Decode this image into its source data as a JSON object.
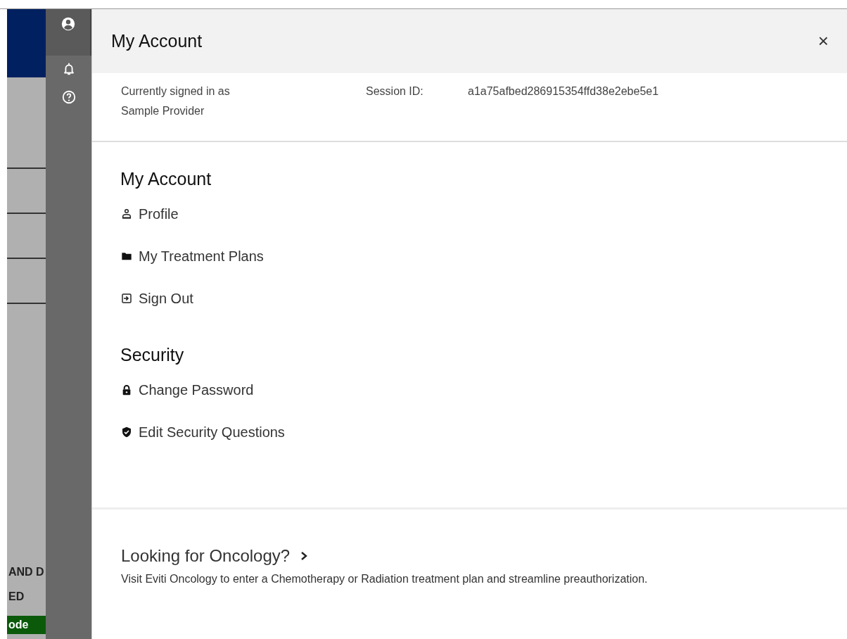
{
  "background_app": {
    "texts": [
      "AND D",
      "ED"
    ],
    "button": "ode"
  },
  "sidebar": {
    "items": [
      {
        "kind": "user",
        "selected": true
      },
      {
        "kind": "bell",
        "selected": false
      },
      {
        "kind": "help",
        "selected": false
      }
    ]
  },
  "panel": {
    "title": "My Account",
    "close": "×",
    "signed_in_label": "Currently signed in as",
    "user_name": "Sample Provider",
    "session_label": "Session ID:",
    "session_id": "a1a75afbed286915354ffd38e2ebe5e1",
    "sections": [
      {
        "heading": "My Account",
        "items": [
          {
            "kind": "profile",
            "label": "Profile"
          },
          {
            "kind": "folder",
            "label": "My Treatment Plans"
          },
          {
            "kind": "signout",
            "label": "Sign Out"
          }
        ]
      },
      {
        "heading": "Security",
        "items": [
          {
            "kind": "lock",
            "label": "Change Password"
          },
          {
            "kind": "shield",
            "label": "Edit Security Questions"
          }
        ]
      }
    ],
    "promo": {
      "title": "Looking for Oncology?",
      "text": "Visit Eviti Oncology to enter a Chemotherapy or Radiation treatment plan and streamline preauthorization."
    }
  }
}
